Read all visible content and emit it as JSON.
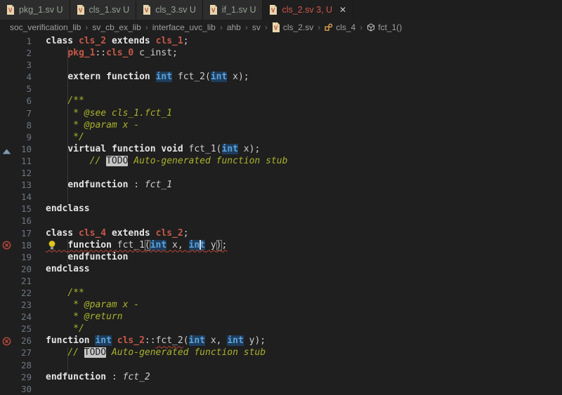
{
  "tabs": [
    {
      "label": "pkg_1.sv U",
      "active": false
    },
    {
      "label": "cls_1.sv U",
      "active": false
    },
    {
      "label": "cls_3.sv U",
      "active": false
    },
    {
      "label": "if_1.sv U",
      "active": false
    },
    {
      "label": "cls_2.sv 3, U",
      "active": true,
      "close_label": "✕"
    }
  ],
  "breadcrumb": {
    "separator": "›",
    "items": [
      {
        "label": "soc_verification_lib"
      },
      {
        "label": "sv_cb_ex_lib"
      },
      {
        "label": "interface_uvc_lib"
      },
      {
        "label": "ahb"
      },
      {
        "label": "sv"
      },
      {
        "label": "cls_2.sv",
        "icon": "file-icon"
      },
      {
        "label": "cls_4",
        "icon": "class-icon"
      },
      {
        "label": "fct_1()",
        "icon": "method-icon"
      }
    ]
  },
  "editor": {
    "lines": [
      {
        "n": 1,
        "seg": [
          [
            "k",
            "class"
          ],
          [
            "i",
            " "
          ],
          [
            "c",
            "cls_2"
          ],
          [
            "i",
            " "
          ],
          [
            "k",
            "extends"
          ],
          [
            "i",
            " "
          ],
          [
            "c",
            "cls_1"
          ],
          [
            "i",
            ";"
          ]
        ]
      },
      {
        "n": 2,
        "seg": [
          [
            "i",
            "    "
          ],
          [
            "c",
            "pkg_1"
          ],
          [
            "i",
            "::"
          ],
          [
            "c",
            "cls_0"
          ],
          [
            "i",
            " c_inst;"
          ]
        ]
      },
      {
        "n": 3,
        "seg": []
      },
      {
        "n": 4,
        "seg": [
          [
            "i",
            "    "
          ],
          [
            "k",
            "extern"
          ],
          [
            "i",
            " "
          ],
          [
            "k",
            "function"
          ],
          [
            "i",
            " "
          ],
          [
            "t",
            "int"
          ],
          [
            "i",
            " fct_2("
          ],
          [
            "t",
            "int"
          ],
          [
            "i",
            " x);"
          ]
        ]
      },
      {
        "n": 5,
        "seg": []
      },
      {
        "n": 6,
        "seg": [
          [
            "m",
            "    /**"
          ]
        ]
      },
      {
        "n": 7,
        "seg": [
          [
            "m",
            "     * @see cls_1.fct_1"
          ]
        ]
      },
      {
        "n": 8,
        "seg": [
          [
            "m",
            "     * @param x -"
          ]
        ]
      },
      {
        "n": 9,
        "seg": [
          [
            "m",
            "     */"
          ]
        ]
      },
      {
        "n": 10,
        "seg": [
          [
            "i",
            "    "
          ],
          [
            "k",
            "virtual"
          ],
          [
            "i",
            " "
          ],
          [
            "k",
            "function"
          ],
          [
            "i",
            " "
          ],
          [
            "k",
            "void"
          ],
          [
            "i",
            " fct_1("
          ],
          [
            "t",
            "int"
          ],
          [
            "i",
            " x);"
          ]
        ]
      },
      {
        "n": 11,
        "seg": [
          [
            "i",
            "        "
          ],
          [
            "m",
            "// "
          ],
          [
            "d",
            "TODO"
          ],
          [
            "m",
            " Auto-generated function stub"
          ]
        ]
      },
      {
        "n": 12,
        "seg": []
      },
      {
        "n": 13,
        "seg": [
          [
            "i",
            "    "
          ],
          [
            "k",
            "endfunction"
          ],
          [
            "i",
            " : "
          ],
          [
            "f",
            "fct_1"
          ]
        ]
      },
      {
        "n": 14,
        "seg": []
      },
      {
        "n": 15,
        "seg": [
          [
            "k",
            "endclass"
          ]
        ]
      },
      {
        "n": 16,
        "seg": []
      },
      {
        "n": 17,
        "seg": [
          [
            "k",
            "class"
          ],
          [
            "i",
            " "
          ],
          [
            "c",
            "cls_4"
          ],
          [
            "i",
            " "
          ],
          [
            "k",
            "extends"
          ],
          [
            "i",
            " "
          ],
          [
            "c",
            "cls_2"
          ],
          [
            "i",
            ";"
          ]
        ]
      },
      {
        "n": 18,
        "wrap": "sq",
        "seg": [
          [
            "i",
            "    "
          ],
          [
            "k",
            "function"
          ],
          [
            "i",
            " fct_1"
          ],
          [
            "bx",
            "("
          ],
          [
            "t",
            "int"
          ],
          [
            "i",
            " x, "
          ],
          [
            "t",
            "int"
          ],
          [
            "i",
            " y"
          ],
          [
            "bx",
            ")"
          ],
          [
            "i",
            ";"
          ]
        ]
      },
      {
        "n": 19,
        "seg": [
          [
            "i",
            "    "
          ],
          [
            "k",
            "endfunction"
          ]
        ]
      },
      {
        "n": 20,
        "seg": [
          [
            "k",
            "endclass"
          ]
        ]
      },
      {
        "n": 21,
        "seg": []
      },
      {
        "n": 22,
        "seg": [
          [
            "m",
            "    /**"
          ]
        ]
      },
      {
        "n": 23,
        "seg": [
          [
            "m",
            "     * @param x -"
          ]
        ]
      },
      {
        "n": 24,
        "seg": [
          [
            "m",
            "     * @return"
          ]
        ]
      },
      {
        "n": 25,
        "seg": [
          [
            "m",
            "     */"
          ]
        ]
      },
      {
        "n": 26,
        "seg": [
          [
            "k",
            "function"
          ],
          [
            "i",
            " "
          ],
          [
            "t",
            "int"
          ],
          [
            "i",
            " "
          ],
          [
            "c",
            "cls_2"
          ],
          [
            "i",
            "::"
          ],
          [
            "u",
            "fct_2"
          ],
          [
            "i",
            "("
          ],
          [
            "t",
            "int"
          ],
          [
            "i",
            " x, "
          ],
          [
            "t",
            "int"
          ],
          [
            "i",
            " y);"
          ]
        ]
      },
      {
        "n": 27,
        "seg": [
          [
            "i",
            "    "
          ],
          [
            "m",
            "// "
          ],
          [
            "d",
            "TODO"
          ],
          [
            "m",
            " Auto-generated function stub"
          ]
        ]
      },
      {
        "n": 28,
        "seg": []
      },
      {
        "n": 29,
        "seg": [
          [
            "k",
            "endfunction"
          ],
          [
            "i",
            " : "
          ],
          [
            "f",
            "fct_2"
          ]
        ]
      },
      {
        "n": 30,
        "seg": []
      }
    ],
    "decorations": {
      "error_lines": [
        18,
        26
      ],
      "implementation_line": 10,
      "lightbulb_line": 18,
      "cursor": {
        "line": 18,
        "col": 28
      },
      "indent_guides": [
        {
          "from": 2,
          "to": 14
        },
        {
          "from": 18,
          "to": 19
        },
        {
          "from": 27,
          "to": 28
        }
      ]
    },
    "colors": {
      "background": "#1f1f1f",
      "keyword": "#e5e5e5",
      "type": "#5ba3dd",
      "type_highlight_bg": "#1e3d5c",
      "class_name": "#c65849",
      "comment": "#a9b22c",
      "error": "#bf4434",
      "active_tab_label": "#d1584a",
      "line_number": "#6d7680"
    }
  }
}
